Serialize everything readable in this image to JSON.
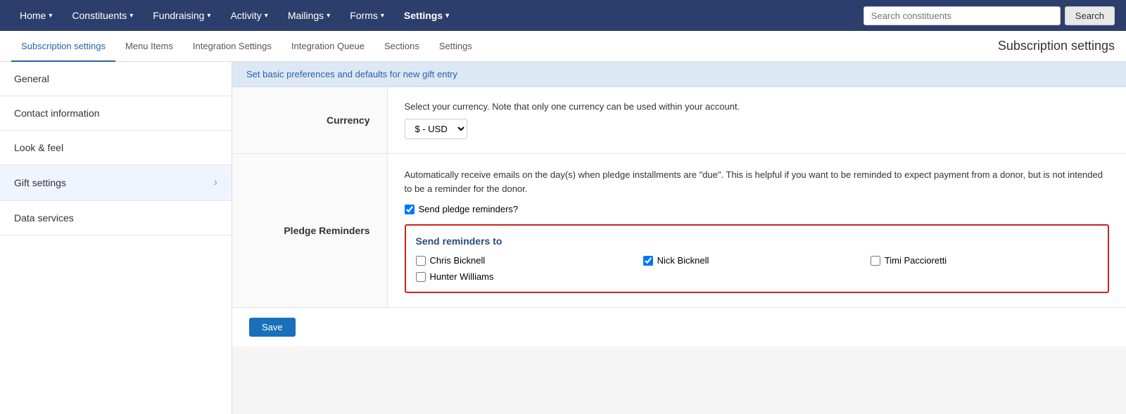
{
  "topNav": {
    "items": [
      {
        "id": "home",
        "label": "Home",
        "hasDropdown": true
      },
      {
        "id": "constituents",
        "label": "Constituents",
        "hasDropdown": true
      },
      {
        "id": "fundraising",
        "label": "Fundraising",
        "hasDropdown": true
      },
      {
        "id": "activity",
        "label": "Activity",
        "hasDropdown": true
      },
      {
        "id": "mailings",
        "label": "Mailings",
        "hasDropdown": true
      },
      {
        "id": "forms",
        "label": "Forms",
        "hasDropdown": true
      },
      {
        "id": "settings",
        "label": "Settings",
        "hasDropdown": true,
        "active": true
      }
    ],
    "searchPlaceholder": "Search constituents",
    "searchButtonLabel": "Search"
  },
  "subNav": {
    "items": [
      {
        "id": "subscription-settings",
        "label": "Subscription settings",
        "active": true
      },
      {
        "id": "menu-items",
        "label": "Menu Items"
      },
      {
        "id": "integration-settings",
        "label": "Integration Settings"
      },
      {
        "id": "integration-queue",
        "label": "Integration Queue"
      },
      {
        "id": "sections",
        "label": "Sections"
      },
      {
        "id": "settings",
        "label": "Settings"
      }
    ],
    "pageTitle": "Subscription settings"
  },
  "sidebar": {
    "items": [
      {
        "id": "general",
        "label": "General",
        "hasChevron": false
      },
      {
        "id": "contact-information",
        "label": "Contact information",
        "hasChevron": false
      },
      {
        "id": "look-feel",
        "label": "Look & feel",
        "hasChevron": false
      },
      {
        "id": "gift-settings",
        "label": "Gift settings",
        "hasChevron": true,
        "active": true
      },
      {
        "id": "data-services",
        "label": "Data services",
        "hasChevron": false
      }
    ]
  },
  "content": {
    "headerText": "Set basic preferences and defaults for new gift entry",
    "sections": [
      {
        "id": "currency",
        "label": "Currency",
        "description": "Select your currency. Note that only one currency can be used within your account.",
        "currencyValue": "$ - USD"
      },
      {
        "id": "pledge-reminders",
        "label": "Pledge Reminders",
        "description": "Automatically receive emails on the day(s) when pledge installments are \"due\". This is helpful if you want to be reminded to expect payment from a donor, but is not intended to be a reminder for the donor.",
        "sendPledgeLabel": "Send pledge reminders?",
        "sendPledgeChecked": true,
        "sendRemindersTitle": "Send reminders to",
        "recipients": [
          {
            "id": "chris-bicknell",
            "name": "Chris Bicknell",
            "checked": false
          },
          {
            "id": "nick-bicknell",
            "name": "Nick Bicknell",
            "checked": true
          },
          {
            "id": "timi-paccioretti",
            "name": "Timi Paccioretti",
            "checked": false
          },
          {
            "id": "hunter-williams",
            "name": "Hunter Williams",
            "checked": false
          }
        ]
      }
    ],
    "saveLabel": "Save"
  }
}
